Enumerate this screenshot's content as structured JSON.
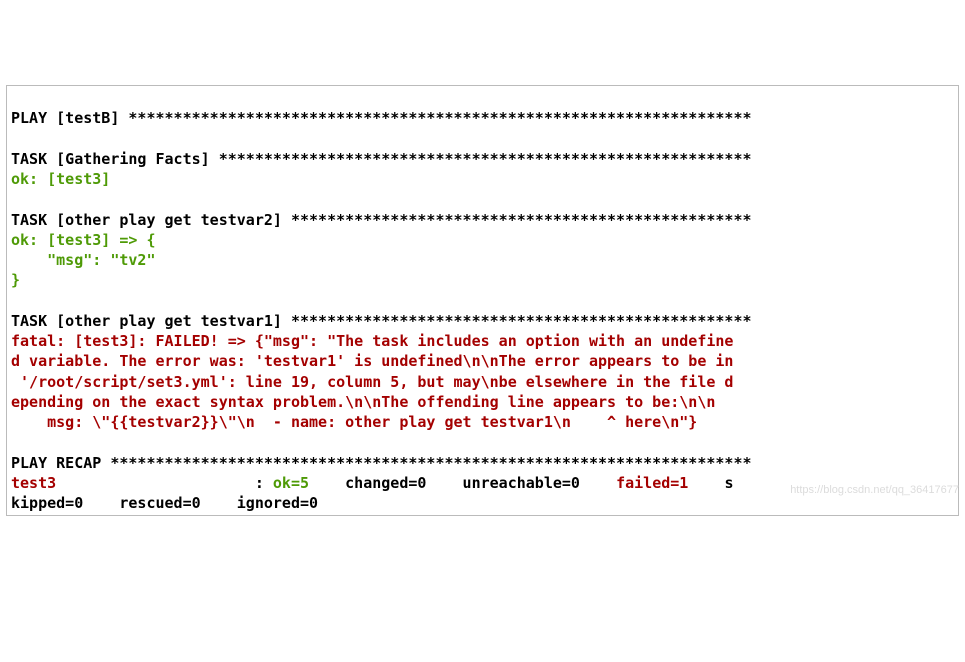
{
  "play_header": "PLAY [testB] *********************************************************************",
  "blank": "",
  "task1_header": "TASK [Gathering Facts] ***********************************************************",
  "task1_ok": "ok: [test3]",
  "task2_header": "TASK [other play get testvar2] ***************************************************",
  "task2_ok_l1": "ok: [test3] => {",
  "task2_ok_l2": "    \"msg\": \"tv2\"",
  "task2_ok_l3": "}",
  "task3_header": "TASK [other play get testvar1] ***************************************************",
  "task3_fatal_l1": "fatal: [test3]: FAILED! => {\"msg\": \"The task includes an option with an undefine",
  "task3_fatal_l2": "d variable. The error was: 'testvar1' is undefined\\n\\nThe error appears to be in",
  "task3_fatal_l3": " '/root/script/set3.yml': line 19, column 5, but may\\nbe elsewhere in the file d",
  "task3_fatal_l4": "epending on the exact syntax problem.\\n\\nThe offending line appears to be:\\n\\n",
  "task3_fatal_l5": "    msg: \\\"{{testvar2}}\\\"\\n  - name: other play get testvar1\\n    ^ here\\n\"}",
  "recap_header": "PLAY RECAP ***********************************************************************",
  "recap_host": "test3",
  "recap_colon": "                      : ",
  "recap_ok": "ok=5   ",
  "recap_changed": " changed=0    unreachable=0    ",
  "recap_failed": "failed=1   ",
  "recap_tail1": " s",
  "recap_line2": "kipped=0    rescued=0    ignored=0",
  "watermark": "https://blog.csdn.net/qq_36417677"
}
